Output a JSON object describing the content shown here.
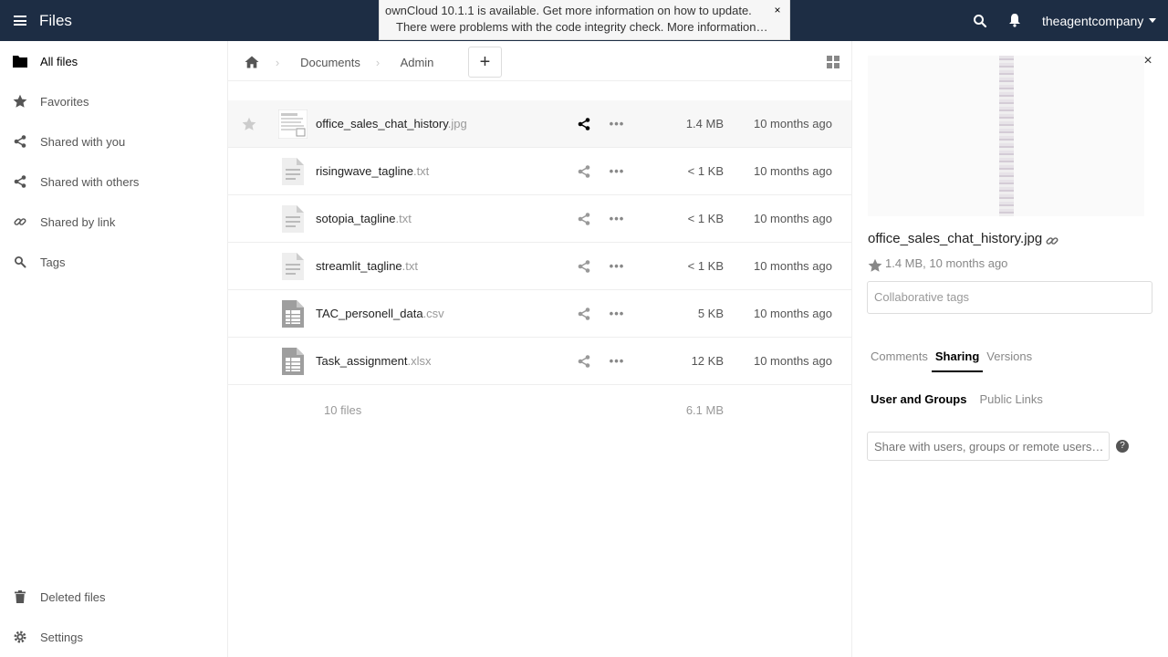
{
  "header": {
    "app_name": "Files",
    "user_name": "theagentcompany"
  },
  "notifications": {
    "update": "ownCloud 10.1.1 is available. Get more information on how to update.",
    "integrity": "There were problems with the code integrity check. More information…",
    "close_glyph": "×"
  },
  "sidebar": {
    "items": [
      {
        "label": "All files",
        "icon": "folder-icon"
      },
      {
        "label": "Favorites",
        "icon": "star-icon"
      },
      {
        "label": "Shared with you",
        "icon": "share-icon"
      },
      {
        "label": "Shared with others",
        "icon": "share-icon"
      },
      {
        "label": "Shared by link",
        "icon": "link-icon"
      },
      {
        "label": "Tags",
        "icon": "tag-icon"
      }
    ],
    "bottom": [
      {
        "label": "Deleted files",
        "icon": "trash-icon"
      },
      {
        "label": "Settings",
        "icon": "gear-icon"
      }
    ]
  },
  "breadcrumb": {
    "items": [
      "Documents",
      "Admin"
    ],
    "separator": "›",
    "new_label": "+"
  },
  "files": [
    {
      "base": "office_sales_chat_history",
      "ext": ".jpg",
      "size": "1.4 MB",
      "date": "10 months ago",
      "type": "image"
    },
    {
      "base": "risingwave_tagline",
      "ext": ".txt",
      "size": "< 1 KB",
      "date": "10 months ago",
      "type": "text"
    },
    {
      "base": "sotopia_tagline",
      "ext": ".txt",
      "size": "< 1 KB",
      "date": "10 months ago",
      "type": "text"
    },
    {
      "base": "streamlit_tagline",
      "ext": ".txt",
      "size": "< 1 KB",
      "date": "10 months ago",
      "type": "text"
    },
    {
      "base": "TAC_personell_data",
      "ext": ".csv",
      "size": "5 KB",
      "date": "10 months ago",
      "type": "spreadsheet"
    },
    {
      "base": "Task_assignment",
      "ext": ".xlsx",
      "size": "12 KB",
      "date": "10 months ago",
      "type": "spreadsheet"
    }
  ],
  "row_actions": {
    "more_glyph": "•••"
  },
  "summary": {
    "count": "10 files",
    "total": "6.1 MB"
  },
  "details": {
    "close_glyph": "×",
    "filename": "office_sales_chat_history.jpg",
    "meta": "1.4 MB, 10 months ago",
    "tags_placeholder": "Collaborative tags",
    "tabs": [
      "Comments",
      "Sharing",
      "Versions"
    ],
    "subtabs": [
      "User and Groups",
      "Public Links"
    ],
    "share_placeholder": "Share with users, groups or remote users…",
    "info_glyph": "?"
  }
}
